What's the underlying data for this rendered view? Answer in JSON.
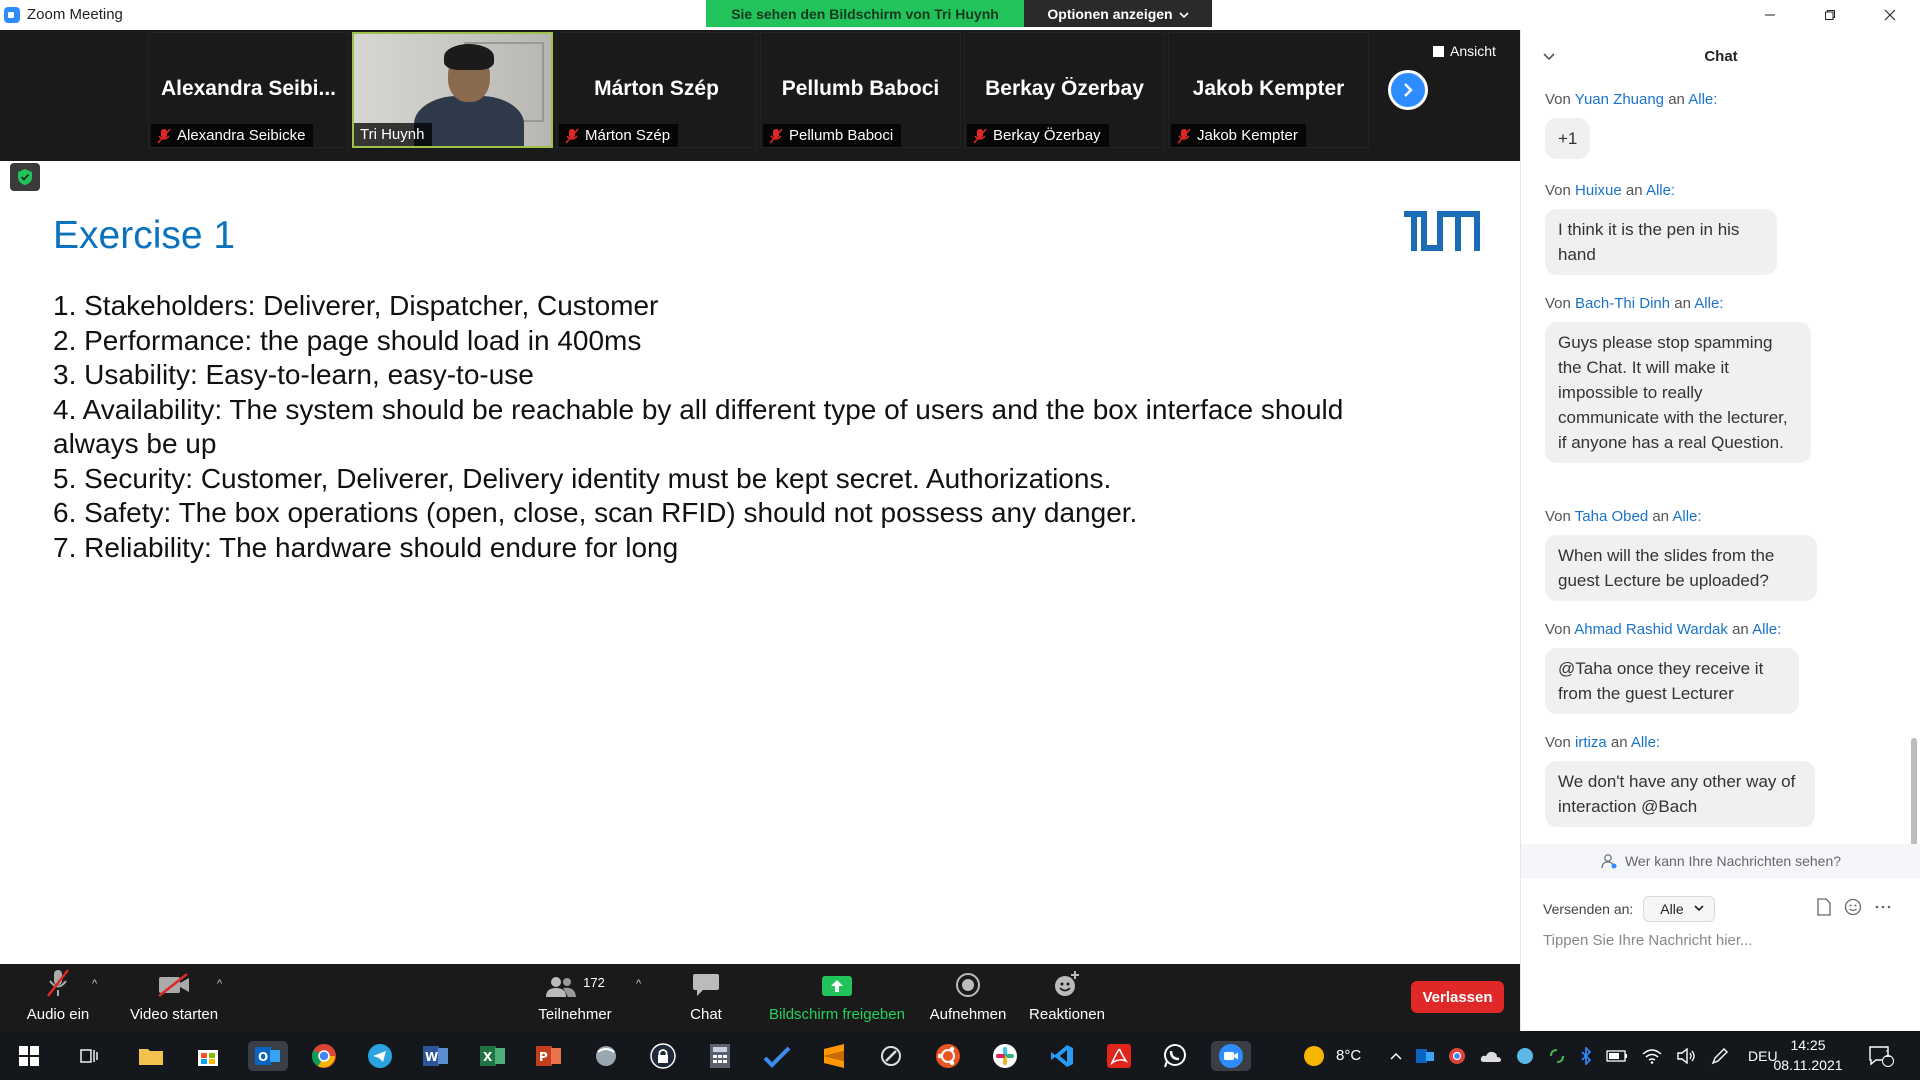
{
  "window": {
    "title": "Zoom Meeting"
  },
  "share_banner": {
    "viewing": "Sie sehen den Bildschirm von Tri Huynh",
    "options": "Optionen anzeigen"
  },
  "strip": {
    "view_label": "Ansicht",
    "tiles": [
      {
        "big": "Alexandra  Seibi...",
        "small": "Alexandra Seibicke",
        "video": false,
        "muted": true
      },
      {
        "big": "",
        "small": "Tri Huynh",
        "video": true,
        "muted": false
      },
      {
        "big": "Márton Szép",
        "small": "Márton Szép",
        "video": false,
        "muted": true
      },
      {
        "big": "Pellumb Baboci",
        "small": "Pellumb Baboci",
        "video": false,
        "muted": true
      },
      {
        "big": "Berkay Özerbay",
        "small": "Berkay Özerbay",
        "video": false,
        "muted": true
      },
      {
        "big": "Jakob Kempter",
        "small": "Jakob Kempter",
        "video": false,
        "muted": true
      }
    ]
  },
  "slide": {
    "title": "Exercise 1",
    "items": [
      "1. Stakeholders: Deliverer, Dispatcher, Customer",
      "2. Performance: the page should load in 400ms",
      "3. Usability: Easy-to-learn, easy-to-use",
      "4. Availability: The system should be reachable by all different type of users and the box interface should always be up",
      "5. Security: Customer, Deliverer, Delivery identity must be kept secret. Authorizations.",
      "6. Safety: The box operations (open, close, scan RFID) should not possess any danger.",
      "7. Reliability: The hardware should endure for long"
    ]
  },
  "toolbar": {
    "audio": "Audio ein",
    "video": "Video starten",
    "participants": "Teilnehmer",
    "participants_count": "172",
    "chat": "Chat",
    "share": "Bildschirm freigeben",
    "record": "Aufnehmen",
    "reactions": "Reaktionen",
    "leave": "Verlassen"
  },
  "chat": {
    "title": "Chat",
    "from_prefix": "Von",
    "to_word": "an",
    "to_target": "Alle:",
    "messages": [
      {
        "from": "Yuan Zhuang",
        "text": "+1"
      },
      {
        "from": "Huixue",
        "text": "I think it is the pen in his hand"
      },
      {
        "from": "Bach-Thi Dinh",
        "text": "Guys please stop spamming the Chat. It will make it impossible to really communicate with the lecturer, if anyone has a real Question."
      },
      {
        "from": "Taha Obed",
        "text": "When will the slides from the guest Lecture be uploaded?"
      },
      {
        "from": "Ahmad Rashid Wardak",
        "text": "@Taha once they receive it from the guest Lecturer"
      },
      {
        "from": "irtiza",
        "text": "We don't have any other way of interaction @Bach"
      }
    ],
    "who_can_see": "Wer kann Ihre Nachrichten sehen?",
    "send_to_label": "Versenden an:",
    "send_to_value": "Alle",
    "input_placeholder": "Tippen Sie Ihre Nachricht hier..."
  },
  "taskbar": {
    "weather": "8°C",
    "language": "DEU",
    "time": "14:25",
    "date": "08.11.2021",
    "notifications": "1"
  },
  "colors": {
    "zoom_blue": "#2d8cff",
    "share_green": "#23c35b",
    "leave_red": "#e02828",
    "slide_title_blue": "#0a72bf"
  }
}
